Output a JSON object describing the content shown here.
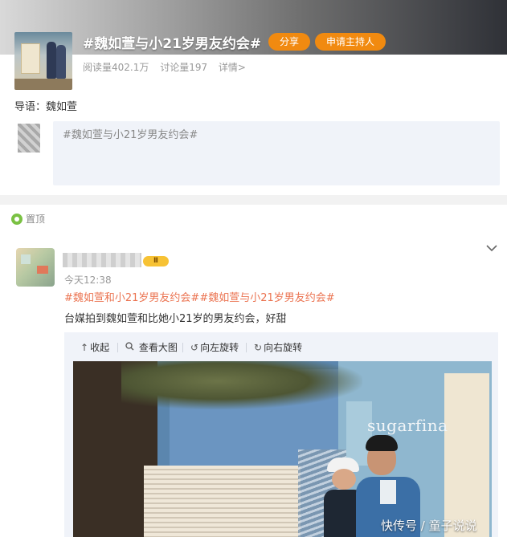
{
  "topic": {
    "title": "#魏如萱与小21岁男友约会#",
    "share_label": "分享",
    "host_label": "申请主持人",
    "reads": "阅读量402.1万",
    "discussions": "讨论量197",
    "details_link": "详情>",
    "guide": "导语：魏如萱",
    "comment_placeholder": "#魏如萱与小21岁男友约会#"
  },
  "feed": {
    "pinned_label": "置顶",
    "vip_badge": "Ⅱ",
    "post": {
      "time": "今天12:38",
      "hashtags": "#魏如萱和小21岁男友约会##魏如萱与小21岁男友约会#",
      "text": "台媒拍到魏如萱和比她小21岁的男友约会，好甜",
      "toolbar": {
        "collapse": "收起",
        "view_large": "查看大图",
        "rotate_left": "向左旋转",
        "rotate_right": "向右旋转"
      },
      "photo_sign_text": "sugarfina"
    }
  },
  "watermark": "快传号 / 童子说说",
  "colors": {
    "accent_orange": "#f18a10",
    "hashtag": "#eb7350",
    "pin_green": "#7ac143"
  },
  "icons": [
    "chevron-down-icon",
    "pin-icon",
    "collapse-arrow-icon",
    "magnifier-icon",
    "rotate-left-icon",
    "rotate-right-icon"
  ]
}
